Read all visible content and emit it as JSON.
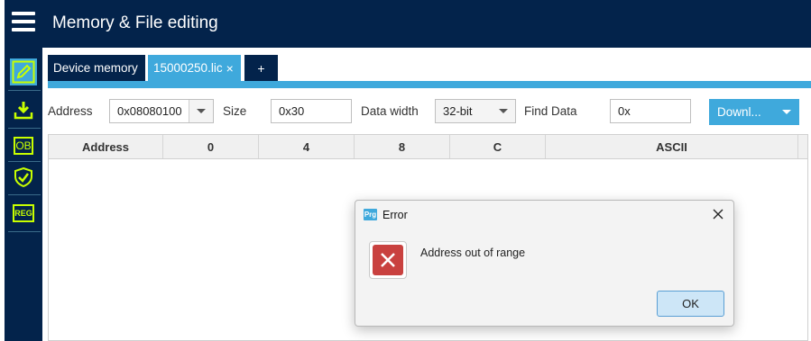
{
  "header": {
    "title": "Memory & File editing"
  },
  "sidebar": {
    "items": [
      {
        "icon": "edit-icon",
        "active": true
      },
      {
        "icon": "download-icon",
        "active": false
      },
      {
        "icon": "ob-icon",
        "label": "OB",
        "active": false
      },
      {
        "icon": "shield-icon",
        "active": false
      },
      {
        "icon": "reg-icon",
        "label": "REG",
        "active": false
      }
    ]
  },
  "tabs": [
    {
      "label": "Device memory"
    },
    {
      "label": "15000250.lic",
      "close": "×"
    },
    {
      "label": "+"
    }
  ],
  "toolbar": {
    "address_label": "Address",
    "address_value": "0x08080100",
    "size_label": "Size",
    "size_value": "0x30",
    "data_width_label": "Data width",
    "data_width_value": "32-bit",
    "find_data_label": "Find Data",
    "find_data_value": "0x",
    "download_label": "Downl..."
  },
  "table": {
    "columns": [
      "Address",
      "0",
      "4",
      "8",
      "C",
      "ASCII"
    ]
  },
  "dialog": {
    "app_icon": "Prg",
    "title": "Error",
    "message": "Address out of range",
    "ok_label": "OK"
  },
  "colors": {
    "header_bg": "#03234b",
    "accent": "#3fa9dc",
    "error_red": "#c9413f"
  }
}
